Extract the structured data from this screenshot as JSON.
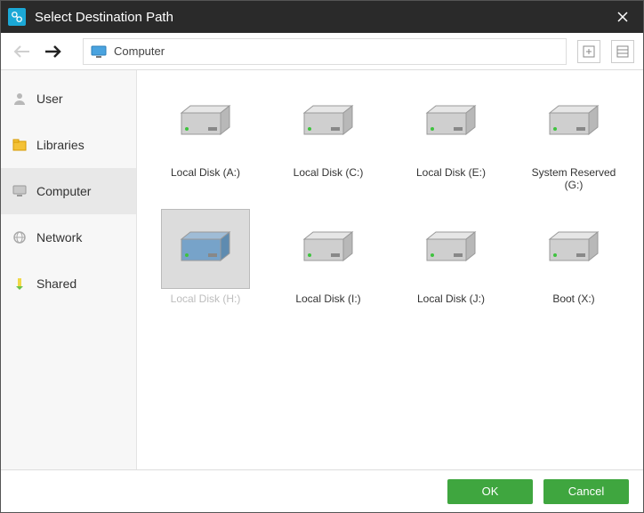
{
  "titlebar": {
    "title": "Select Destination Path"
  },
  "path": {
    "location": "Computer"
  },
  "sidebar": {
    "items": [
      {
        "label": "User"
      },
      {
        "label": "Libraries"
      },
      {
        "label": "Computer"
      },
      {
        "label": "Network"
      },
      {
        "label": "Shared"
      }
    ]
  },
  "drives": [
    {
      "label": "Local Disk (A:)",
      "selected": false
    },
    {
      "label": "Local Disk (C:)",
      "selected": false
    },
    {
      "label": "Local Disk (E:)",
      "selected": false
    },
    {
      "label": "System Reserved (G:)",
      "selected": false
    },
    {
      "label": "Local Disk (H:)",
      "selected": true
    },
    {
      "label": "Local Disk (I:)",
      "selected": false
    },
    {
      "label": "Local Disk (J:)",
      "selected": false
    },
    {
      "label": "Boot (X:)",
      "selected": false
    }
  ],
  "footer": {
    "ok": "OK",
    "cancel": "Cancel"
  },
  "colors": {
    "accent": "#3fa63f"
  }
}
